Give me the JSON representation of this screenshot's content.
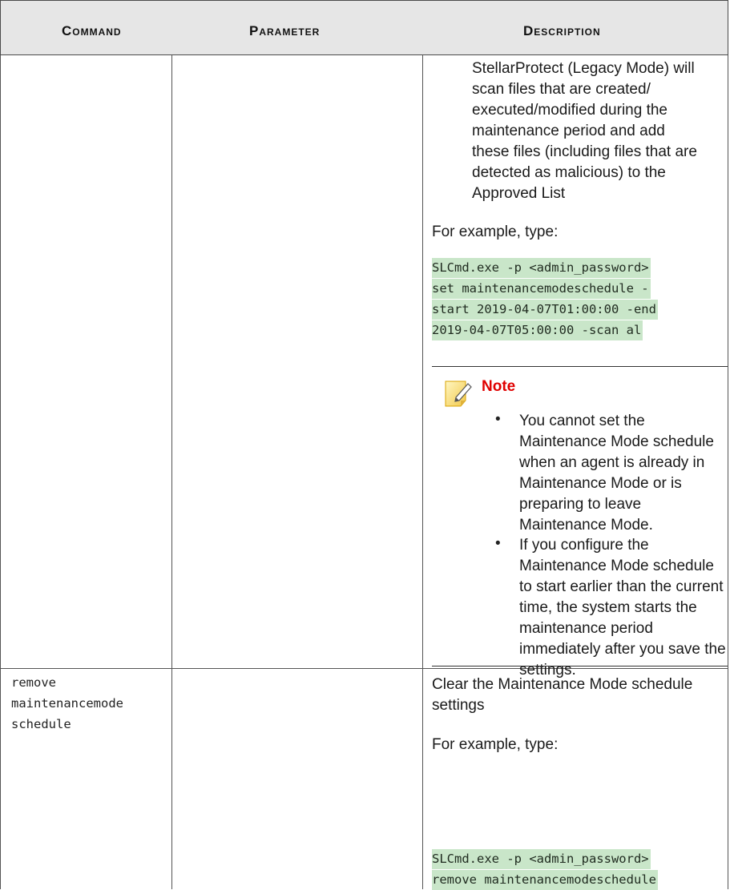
{
  "table": {
    "headers": {
      "command": "Command",
      "parameter": "Parameter",
      "description": "Description"
    }
  },
  "row1": {
    "description_lines": [
      "StellarProtect (Legacy Mode) will",
      "scan files that are created/",
      "executed/modified during the",
      "maintenance period and add",
      "these files (including files that are",
      "detected as malicious) to the",
      "Approved List"
    ],
    "example_label": "For example, type:",
    "code_lines": [
      "SLCmd.exe -p <admin_password>",
      "set maintenancemodeschedule -",
      "start 2019-04-07T01:00:00 -end",
      "2019-04-07T05:00:00 -scan al"
    ],
    "note": {
      "icon": "note-pencil-icon",
      "title": "Note",
      "bullet_glyph": "•",
      "items": [
        "You cannot set the Maintenance Mode schedule when an agent is already in Maintenance Mode or is preparing to leave Maintenance Mode.",
        "If you configure the Maintenance Mode schedule to start earlier than the current time, the system starts the maintenance period immediately after you save the settings."
      ]
    }
  },
  "row2": {
    "command_lines": [
      "remove",
      "maintenancemode",
      "schedule"
    ],
    "description": "Clear the Maintenance Mode schedule settings",
    "example_label": "For example, type:",
    "code_lines": [
      "SLCmd.exe -p <admin_password>",
      "remove maintenancemodeschedule"
    ]
  }
}
